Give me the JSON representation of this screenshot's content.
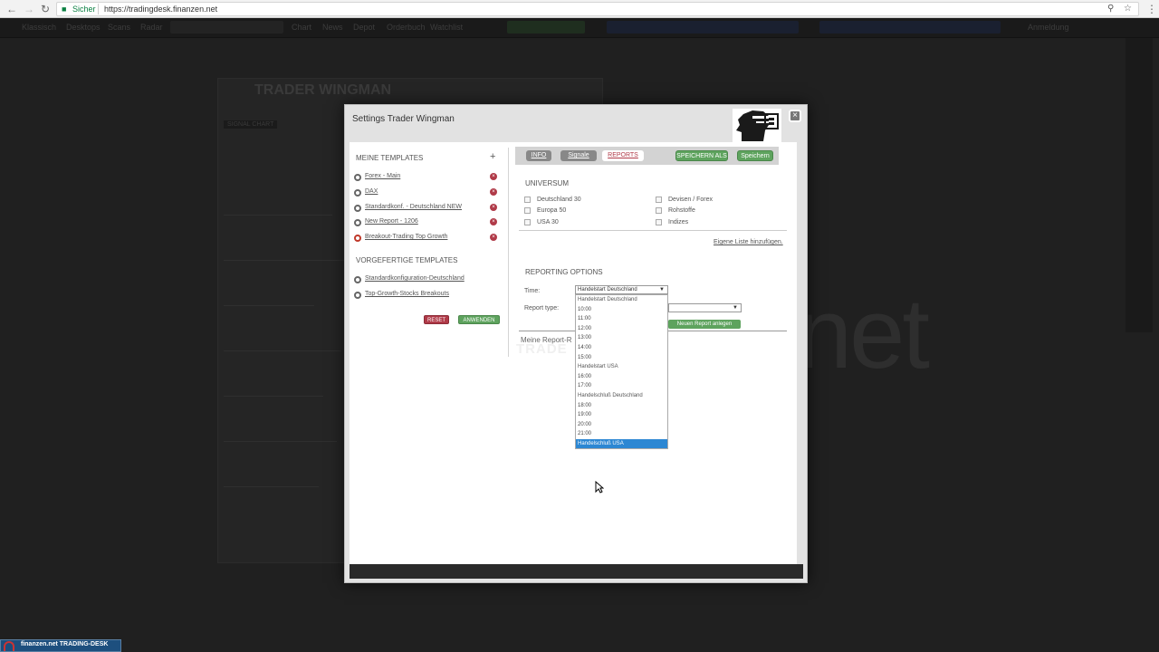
{
  "browser": {
    "secure_label": "Sicher",
    "url": "https://tradingdesk.finanzen.net"
  },
  "app": {
    "nav_items": [
      "Klassisch",
      "Desktops",
      "Scans",
      "Radar",
      "Chart",
      "News",
      "Depot",
      "Orderbuch",
      "Watchlist",
      "Anmeldung"
    ],
    "background_widget_title": "TRADER WINGMAN",
    "background_signal_label": "SIGNAL CHART",
    "footer_logo": "finanzen.net TRADING-DESK"
  },
  "modal": {
    "title": "Settings Trader Wingman",
    "close_symbol": "×",
    "left": {
      "my_templates_heading": "MEINE TEMPLATES",
      "add_symbol": "+",
      "my_templates": [
        {
          "label": "Forex - Main",
          "active": false
        },
        {
          "label": "DAX",
          "active": false
        },
        {
          "label": "Standardkonf. - Deutschland NEW",
          "active": false
        },
        {
          "label": "New Report - 1206",
          "active": false
        },
        {
          "label": "Breakout-Trading Top Growth",
          "active": true
        }
      ],
      "delete_symbol": "×",
      "predefined_heading": "VORGEFERTIGE TEMPLATES",
      "predefined_templates": [
        "Standardkonfiguration-Deutschland",
        "Top-Growth-Stocks Breakouts"
      ],
      "reset_label": "RESET",
      "apply_label": "ANWENDEN"
    },
    "right": {
      "tabs": [
        "INFO",
        "Signale",
        "REPORTS"
      ],
      "save_as_label": "SPEICHERN ALS",
      "save_label": "Speichern",
      "universe_heading": "UNIVERSUM",
      "universe_left": [
        "Deutschland 30",
        "Europa 50",
        "USA 30"
      ],
      "universe_right": [
        "Devisen / Forex",
        "Rohstoffe",
        "Indizes"
      ],
      "own_list_link": "Eigene Liste hinzufügen.",
      "reporting_heading": "REPORTING OPTIONS",
      "time_label": "Time:",
      "time_selected": "Handelstart Deutschland",
      "report_type_label": "Report type:",
      "report_type_selected": "",
      "new_report_label": "Neuen Report anlegen",
      "my_reports_label": "Meine Report-R",
      "watermark_text": "TRADE"
    },
    "dropdown_options": [
      {
        "label": "Handelstart Deutschland",
        "group": true,
        "selected": false
      },
      {
        "label": "10:00",
        "group": false,
        "selected": false
      },
      {
        "label": "11:00",
        "group": false,
        "selected": false
      },
      {
        "label": "12:00",
        "group": false,
        "selected": false
      },
      {
        "label": "13:00",
        "group": false,
        "selected": false
      },
      {
        "label": "14:00",
        "group": false,
        "selected": false
      },
      {
        "label": "15:00",
        "group": false,
        "selected": false
      },
      {
        "label": "Handelstart USA",
        "group": true,
        "selected": false
      },
      {
        "label": "16:00",
        "group": false,
        "selected": false
      },
      {
        "label": "17:00",
        "group": false,
        "selected": false
      },
      {
        "label": "Handelschluß Deutschland",
        "group": true,
        "selected": false
      },
      {
        "label": "18:00",
        "group": false,
        "selected": false
      },
      {
        "label": "19:00",
        "group": false,
        "selected": false
      },
      {
        "label": "20:00",
        "group": false,
        "selected": false
      },
      {
        "label": "21:00",
        "group": false,
        "selected": false
      },
      {
        "label": "Handelschluß USA",
        "group": true,
        "selected": true
      }
    ]
  },
  "colors": {
    "accent_green": "#5ea35e",
    "reset_red": "#b03a48",
    "selected_blue": "#2c87d3",
    "secure_green": "#0b8043"
  }
}
